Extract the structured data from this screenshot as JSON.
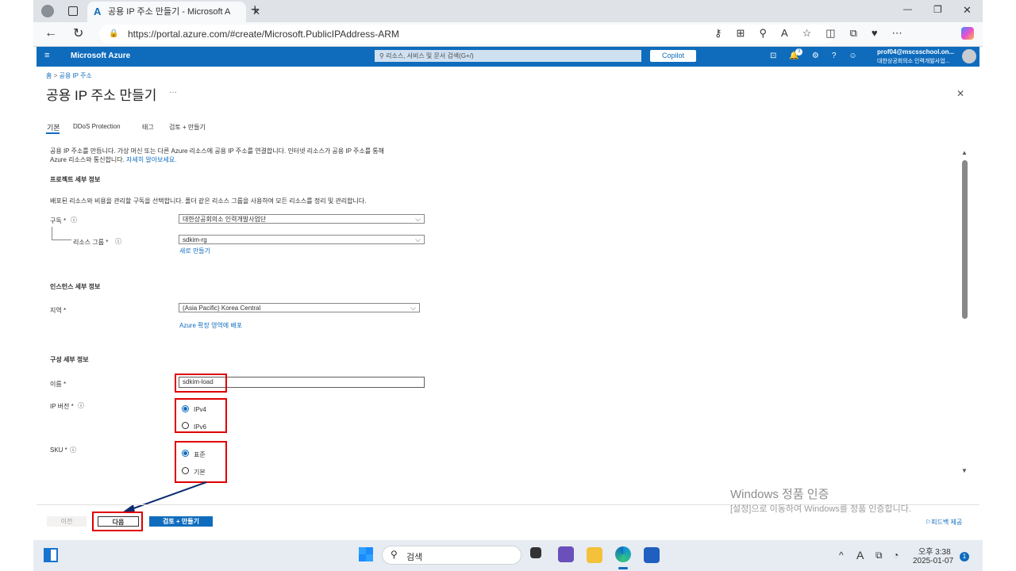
{
  "browser": {
    "tab_title": "공용 IP 주소 만들기 - Microsoft A",
    "url": "https://portal.azure.com/#create/Microsoft.PublicIPAddress-ARM",
    "new_tab": "+",
    "min": "—",
    "restore": "❐",
    "close": "✕"
  },
  "azure": {
    "brand": "Microsoft Azure",
    "search_placeholder": "리소스, 서비스 및 문서 검색(G+/)",
    "copilot": "Copilot",
    "account_email": "prof04@mscsschool.on...",
    "account_org": "대한상공회의소 인력개발사업...",
    "notif_count": "3"
  },
  "page": {
    "breadcrumb_home": "홈",
    "breadcrumb_sep": ">",
    "breadcrumb_item": "공용 IP 주소",
    "title": "공용 IP 주소 만들기",
    "more": "···",
    "close": "✕",
    "tabs": [
      "기본",
      "DDoS Protection",
      "태그",
      "검토 + 만들기"
    ],
    "intro_line1": "공용 IP 주소를 만듭니다. 가상 머신 또는 다른 Azure 리소스에 공용 IP 주소를 연결합니다. 인터넷 리소스가 공용 IP 주소를 통해",
    "intro_line2": "Azure 리소스와 통신합니다.",
    "intro_link": "자세히 알아보세요.",
    "project_section": "프로젝트 세부 정보",
    "project_desc": "배포된 리소스와 비용을 관리할 구독을 선택합니다. 폴더 같은 리소스 그룹을 사용하여 모든 리소스를 정리 및 관리합니다.",
    "subscription_label": "구독 *",
    "subscription_value": "대한상공회의소 인력개발사업단",
    "rg_label": "리소스 그룹 *",
    "rg_value": "sdkim-rg",
    "rg_new": "새로 만들기",
    "instance_section": "인스턴스 세부 정보",
    "region_label": "지역 *",
    "region_value": "(Asia Pacific) Korea Central",
    "region_link": "Azure 확장 영역에 배포",
    "config_section": "구성 세부 정보",
    "name_label": "이름 *",
    "name_value": "sdkim-load",
    "ipver_label": "IP 버전 *",
    "ipv4": "IPv4",
    "ipv6": "IPv6",
    "sku_label": "SKU *",
    "sku_standard": "표준",
    "sku_basic": "기본"
  },
  "footer": {
    "prev": "이전",
    "next": "다음",
    "review": "검토 + 만들기",
    "feedback": "피드백 제공"
  },
  "watermark": {
    "line1": "Windows 정품 인증",
    "line2": "[설정]으로 이동하여 Windows를 정품 인증합니다."
  },
  "taskbar": {
    "search": "검색",
    "time": "오후 3:38",
    "date": "2025-01-07",
    "ime": "A",
    "notif": "1"
  }
}
